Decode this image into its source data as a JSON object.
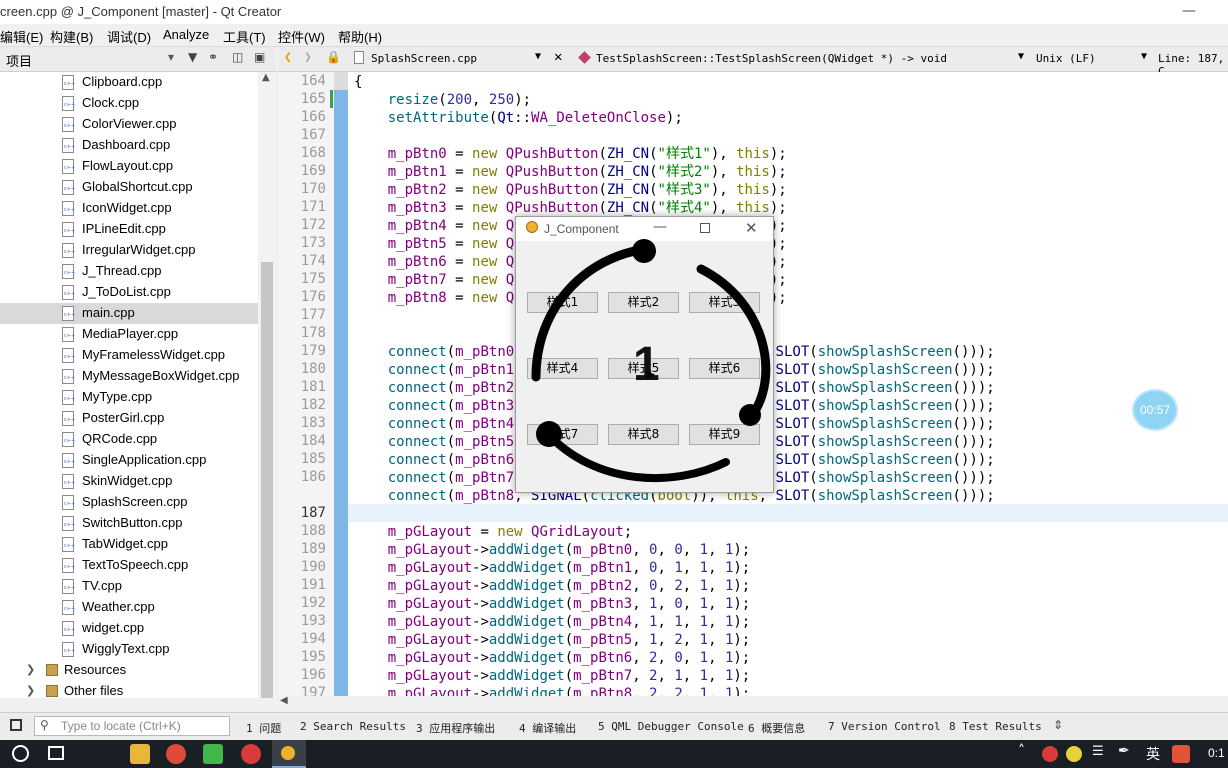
{
  "window": {
    "title": "creen.cpp @ J_Component [master] - Qt Creator"
  },
  "menubar": {
    "items": [
      "编辑(E)",
      "构建(B)",
      "调试(D)",
      "Analyze",
      "工具(T)",
      "控件(W)",
      "帮助(H)"
    ]
  },
  "project_panel": {
    "title": "项目",
    "files": [
      "Clipboard.cpp",
      "Clock.cpp",
      "ColorViewer.cpp",
      "Dashboard.cpp",
      "FlowLayout.cpp",
      "GlobalShortcut.cpp",
      "IconWidget.cpp",
      "IPLineEdit.cpp",
      "IrregularWidget.cpp",
      "J_Thread.cpp",
      "J_ToDoList.cpp",
      "main.cpp",
      "MediaPlayer.cpp",
      "MyFramelessWidget.cpp",
      "MyMessageBoxWidget.cpp",
      "MyType.cpp",
      "PosterGirl.cpp",
      "QRCode.cpp",
      "SingleApplication.cpp",
      "SkinWidget.cpp",
      "SplashScreen.cpp",
      "SwitchButton.cpp",
      "TabWidget.cpp",
      "TextToSpeech.cpp",
      "TV.cpp",
      "Weather.cpp",
      "widget.cpp",
      "WigglyText.cpp"
    ],
    "selected": "main.cpp",
    "folders": [
      "Resources",
      "Other files"
    ]
  },
  "editor": {
    "file": "SplashScreen.cpp",
    "function": "TestSplashScreen::TestSplashScreen(QWidget *) -> void",
    "line_ending": "Unix (LF)",
    "position": "Line: 187, C",
    "line_numbers": [
      "164",
      "165",
      "166",
      "167",
      "168",
      "169",
      "170",
      "171",
      "172",
      "173",
      "174",
      "175",
      "176",
      "177",
      "178",
      "179",
      "180",
      "181",
      "182",
      "183",
      "184",
      "185",
      "186",
      "187",
      "188",
      "189",
      "190",
      "191",
      "192",
      "193",
      "194",
      "195",
      "196",
      "197"
    ],
    "current_line": "187"
  },
  "output_bar": {
    "locate_placeholder": "Type to locate (Ctrl+K)",
    "tabs": [
      "1 问题",
      "2 Search Results",
      "3 应用程序输出",
      "4 编译输出",
      "5 QML Debugger Console",
      "6 概要信息",
      "7 Version Control",
      "8 Test Results"
    ]
  },
  "app_window": {
    "title": "J_Component",
    "buttons": [
      "样式1",
      "样式2",
      "样式3",
      "样式4",
      "样式5",
      "样式6",
      "样式7",
      "样式8",
      "样式9"
    ],
    "countdown": "1"
  },
  "timer_badge": "00:57",
  "taskbar": {
    "ime": "英",
    "clock": "0:1"
  }
}
